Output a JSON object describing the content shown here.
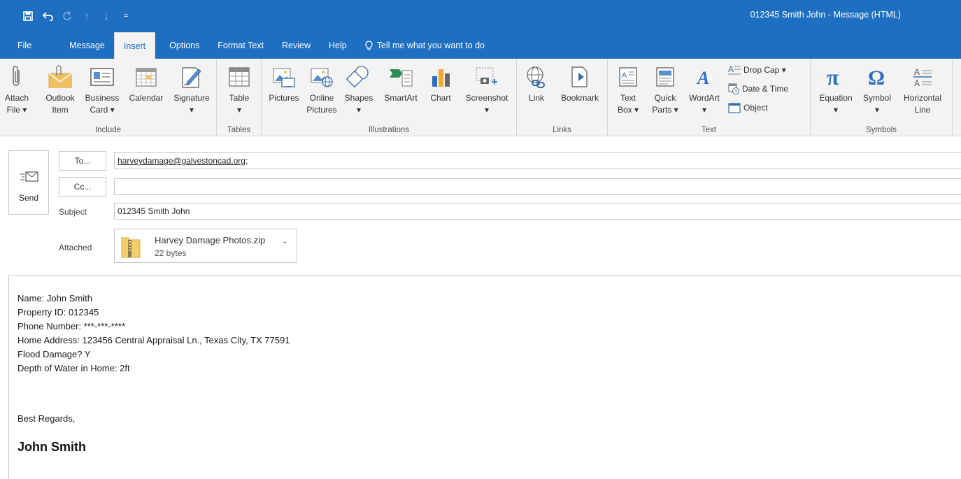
{
  "window": {
    "title": "012345 Smith John  -  Message (HTML)"
  },
  "qat": {
    "icons": [
      "save-icon",
      "undo-icon",
      "redo-icon",
      "up-arrow-icon",
      "down-arrow-icon",
      "customize-icon"
    ]
  },
  "tabs": [
    {
      "label": "File"
    },
    {
      "label": "Message"
    },
    {
      "label": "Insert"
    },
    {
      "label": "Options"
    },
    {
      "label": "Format Text"
    },
    {
      "label": "Review"
    },
    {
      "label": "Help"
    }
  ],
  "tell_me": "Tell me what you want to do",
  "ribbon": {
    "include": {
      "label": "Include",
      "attach_file": "Attach\nFile ▾",
      "outlook_item": "Outlook\nItem",
      "business_card": "Business\nCard ▾",
      "calendar": "Calendar",
      "signature": "Signature\n▾"
    },
    "tables": {
      "label": "Tables",
      "table": "Table\n▾"
    },
    "illustrations": {
      "label": "Illustrations",
      "pictures": "Pictures",
      "online_pictures": "Online\nPictures",
      "shapes": "Shapes\n▾",
      "smartart": "SmartArt",
      "chart": "Chart",
      "screenshot": "Screenshot\n▾"
    },
    "links": {
      "label": "Links",
      "link": "Link",
      "bookmark": "Bookmark"
    },
    "text": {
      "label": "Text",
      "text_box": "Text\nBox ▾",
      "quick_parts": "Quick\nParts ▾",
      "wordart": "WordArt\n▾",
      "drop_cap": "Drop Cap ▾",
      "date_time": "Date & Time",
      "object": "Object"
    },
    "symbols": {
      "label": "Symbols",
      "equation": "Equation\n▾",
      "symbol": "Symbol\n▾",
      "horizontal_line": "Horizontal\nLine"
    }
  },
  "header": {
    "send": "Send",
    "to_button": "To...",
    "cc_button": "Cc...",
    "to_value": "harveydamage@galvestoncad.org;",
    "cc_value": "",
    "subject_label": "Subject",
    "subject_value": "012345 Smith John",
    "attached_label": "Attached",
    "attachment": {
      "name": "Harvey Damage Photos.zip",
      "size": "22 bytes"
    }
  },
  "body": {
    "lines": [
      "Name: John Smith",
      "Property ID: 012345",
      "Phone Number: ***-***-****",
      "Home Address: 123456 Central Appraisal Ln., Texas City, TX 77591",
      "Flood Damage? Y",
      "Depth of Water in Home: 2ft"
    ],
    "closing": "Best Regards,",
    "signature": "John Smith"
  }
}
